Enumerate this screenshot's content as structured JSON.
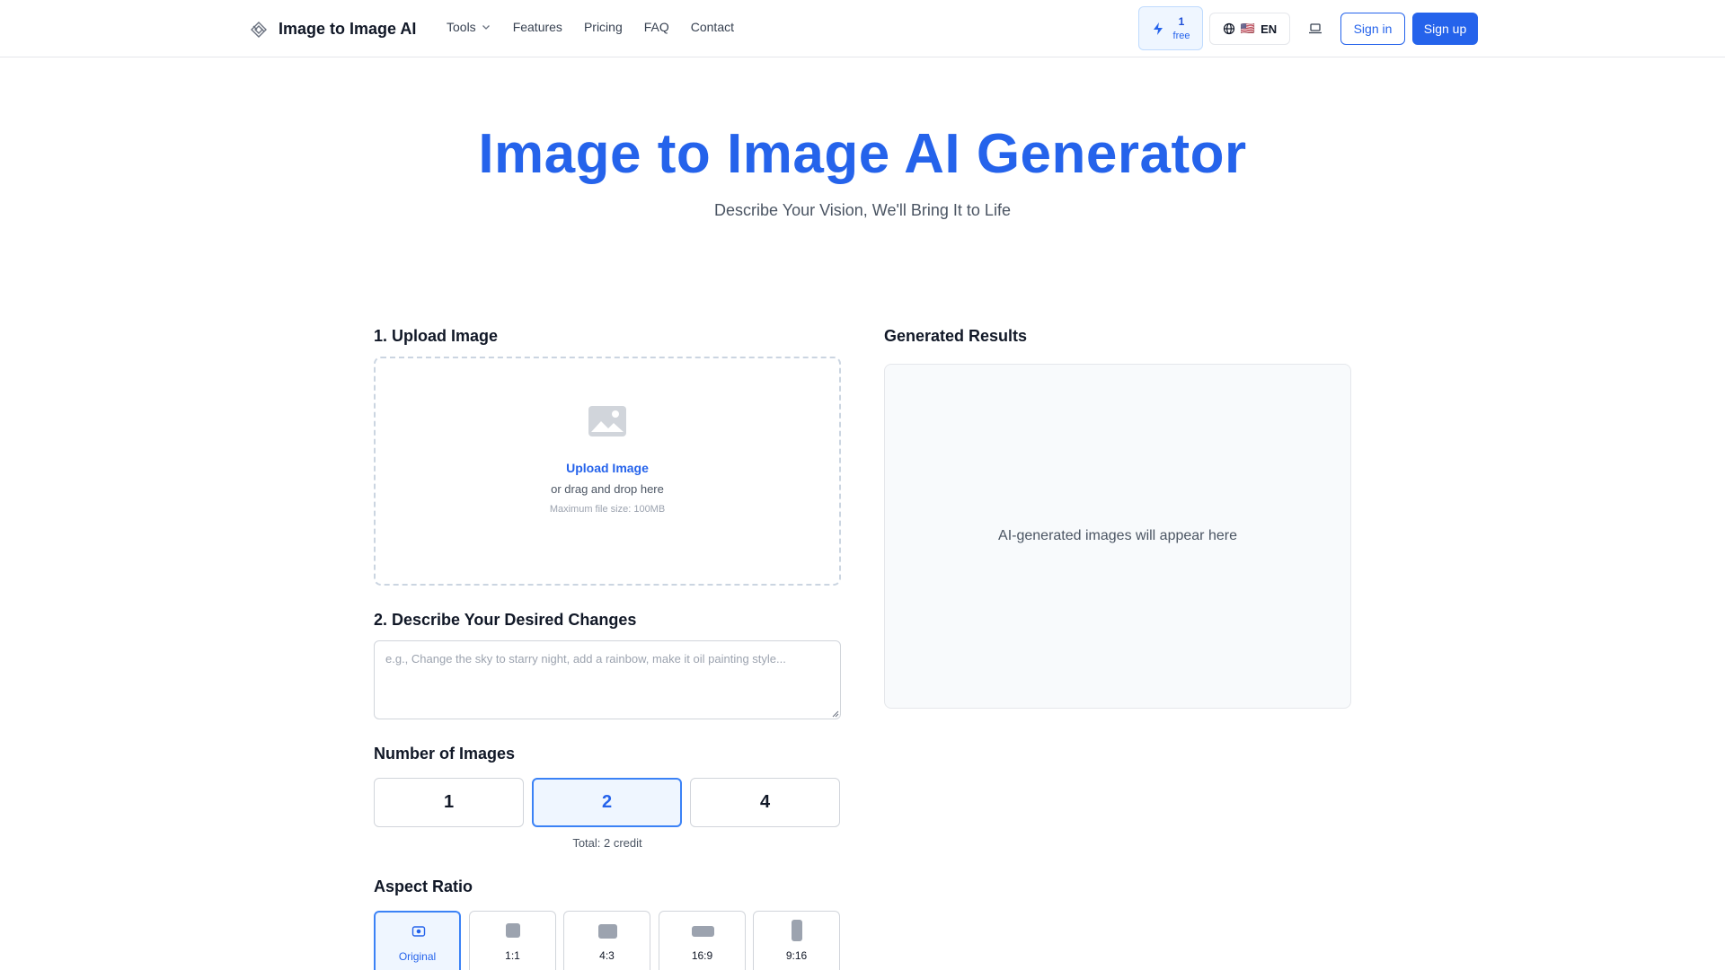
{
  "header": {
    "brand": "Image to Image AI",
    "nav": [
      {
        "label": "Tools",
        "has_dropdown": true
      },
      {
        "label": "Features"
      },
      {
        "label": "Pricing"
      },
      {
        "label": "FAQ"
      },
      {
        "label": "Contact"
      }
    ],
    "credits": {
      "count": "1",
      "label": "free",
      "icon": "bolt-icon"
    },
    "language": {
      "flag": "🇺🇸",
      "code": "EN",
      "icon": "globe-icon"
    },
    "theme_icon": "laptop-icon",
    "signin_label": "Sign in",
    "signup_label": "Sign up"
  },
  "hero": {
    "title": "Image to Image AI Generator",
    "subtitle": "Describe Your Vision, We'll Bring It to Life"
  },
  "upload": {
    "section_label": "1. Upload Image",
    "link_label": "Upload Image",
    "drag_text": "or drag and drop here",
    "max_size": "Maximum file size: 100MB"
  },
  "describe": {
    "section_label": "2. Describe Your Desired Changes",
    "placeholder": "e.g., Change the sky to starry night, add a rainbow, make it oil painting style...",
    "value": ""
  },
  "number_of_images": {
    "section_label": "Number of Images",
    "options": [
      "1",
      "2",
      "4"
    ],
    "selected": "2",
    "total_text": "Total: 2 credit"
  },
  "aspect_ratio": {
    "section_label": "Aspect Ratio",
    "options": [
      "Original",
      "1:1",
      "4:3",
      "16:9",
      "9:16"
    ],
    "selected": "Original"
  },
  "results": {
    "section_label": "Generated Results",
    "empty_text": "AI-generated images will appear here"
  },
  "colors": {
    "primary": "#2563eb",
    "selected_bg": "#eff6ff",
    "border": "#d1d5db"
  }
}
